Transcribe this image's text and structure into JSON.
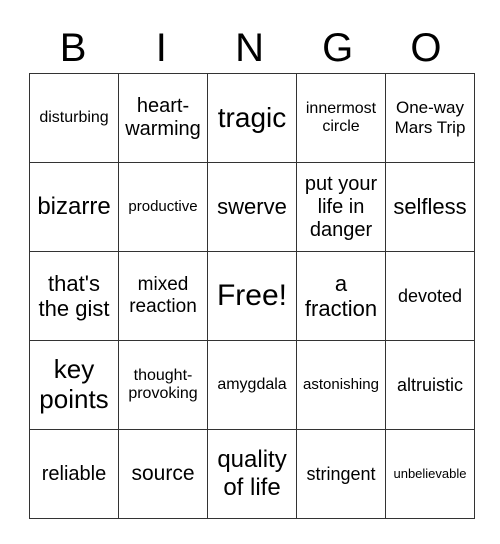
{
  "header": {
    "letters": [
      "B",
      "I",
      "N",
      "G",
      "O"
    ]
  },
  "rows": [
    [
      "disturbing",
      "heart-warming",
      "tragic",
      "innermost circle",
      "One-way Mars Trip"
    ],
    [
      "bizarre",
      "productive",
      "swerve",
      "put your life in danger",
      "selfless"
    ],
    [
      "that's the gist",
      "mixed reaction",
      "Free!",
      "a fraction",
      "devoted"
    ],
    [
      "key points",
      "thought-provoking",
      "amygdala",
      "astonishing",
      "altruistic"
    ],
    [
      "reliable",
      "source",
      "quality of life",
      "stringent",
      "unbelievable"
    ]
  ]
}
